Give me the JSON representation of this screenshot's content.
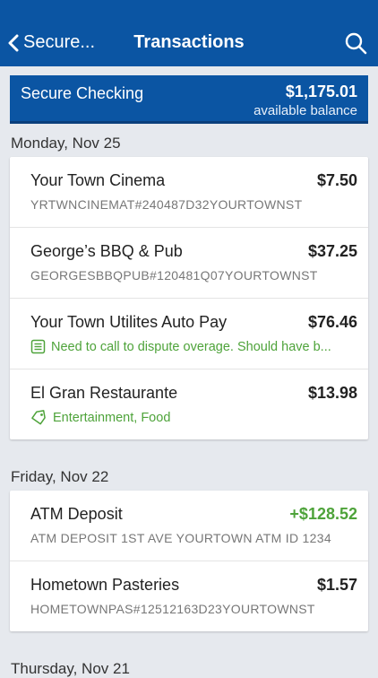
{
  "nav": {
    "back_label": "Secure...",
    "title": "Transactions"
  },
  "account": {
    "name": "Secure Checking",
    "balance": "$1,175.01",
    "balance_label": "available balance"
  },
  "sections": [
    {
      "date": "Monday, Nov 25",
      "transactions": [
        {
          "name": "Your Town Cinema",
          "amount": "$7.50",
          "detail": "YRTWNCINEMAT#240487D32YOURTOWNST"
        },
        {
          "name": "George’s BBQ & Pub",
          "amount": "$37.25",
          "detail": "GEORGESBBQPUB#120481Q07YOURTOWNST"
        },
        {
          "name": "Your Town Utilites Auto Pay",
          "amount": "$76.46",
          "note": "Need to call to dispute overage. Should have b..."
        },
        {
          "name": "El Gran Restaurante",
          "amount": "$13.98",
          "tags": "Entertainment, Food"
        }
      ]
    },
    {
      "date": "Friday, Nov 22",
      "transactions": [
        {
          "name": "ATM Deposit",
          "amount": "+$128.52",
          "detail": "ATM DEPOSIT 1ST AVE YOURTOWN ATM ID 1234"
        },
        {
          "name": "Hometown Pasteries",
          "amount": "$1.57",
          "detail": "HOMETOWNPAS#12512163D23YOURTOWNST"
        }
      ]
    },
    {
      "date": "Thursday, Nov 21"
    }
  ],
  "colors": {
    "brand": "#0b55a3",
    "credit": "#4ea33a",
    "background": "#e6e9ee"
  },
  "icons": [
    "chevron-left-icon",
    "search-icon",
    "note-icon",
    "tag-icon"
  ]
}
